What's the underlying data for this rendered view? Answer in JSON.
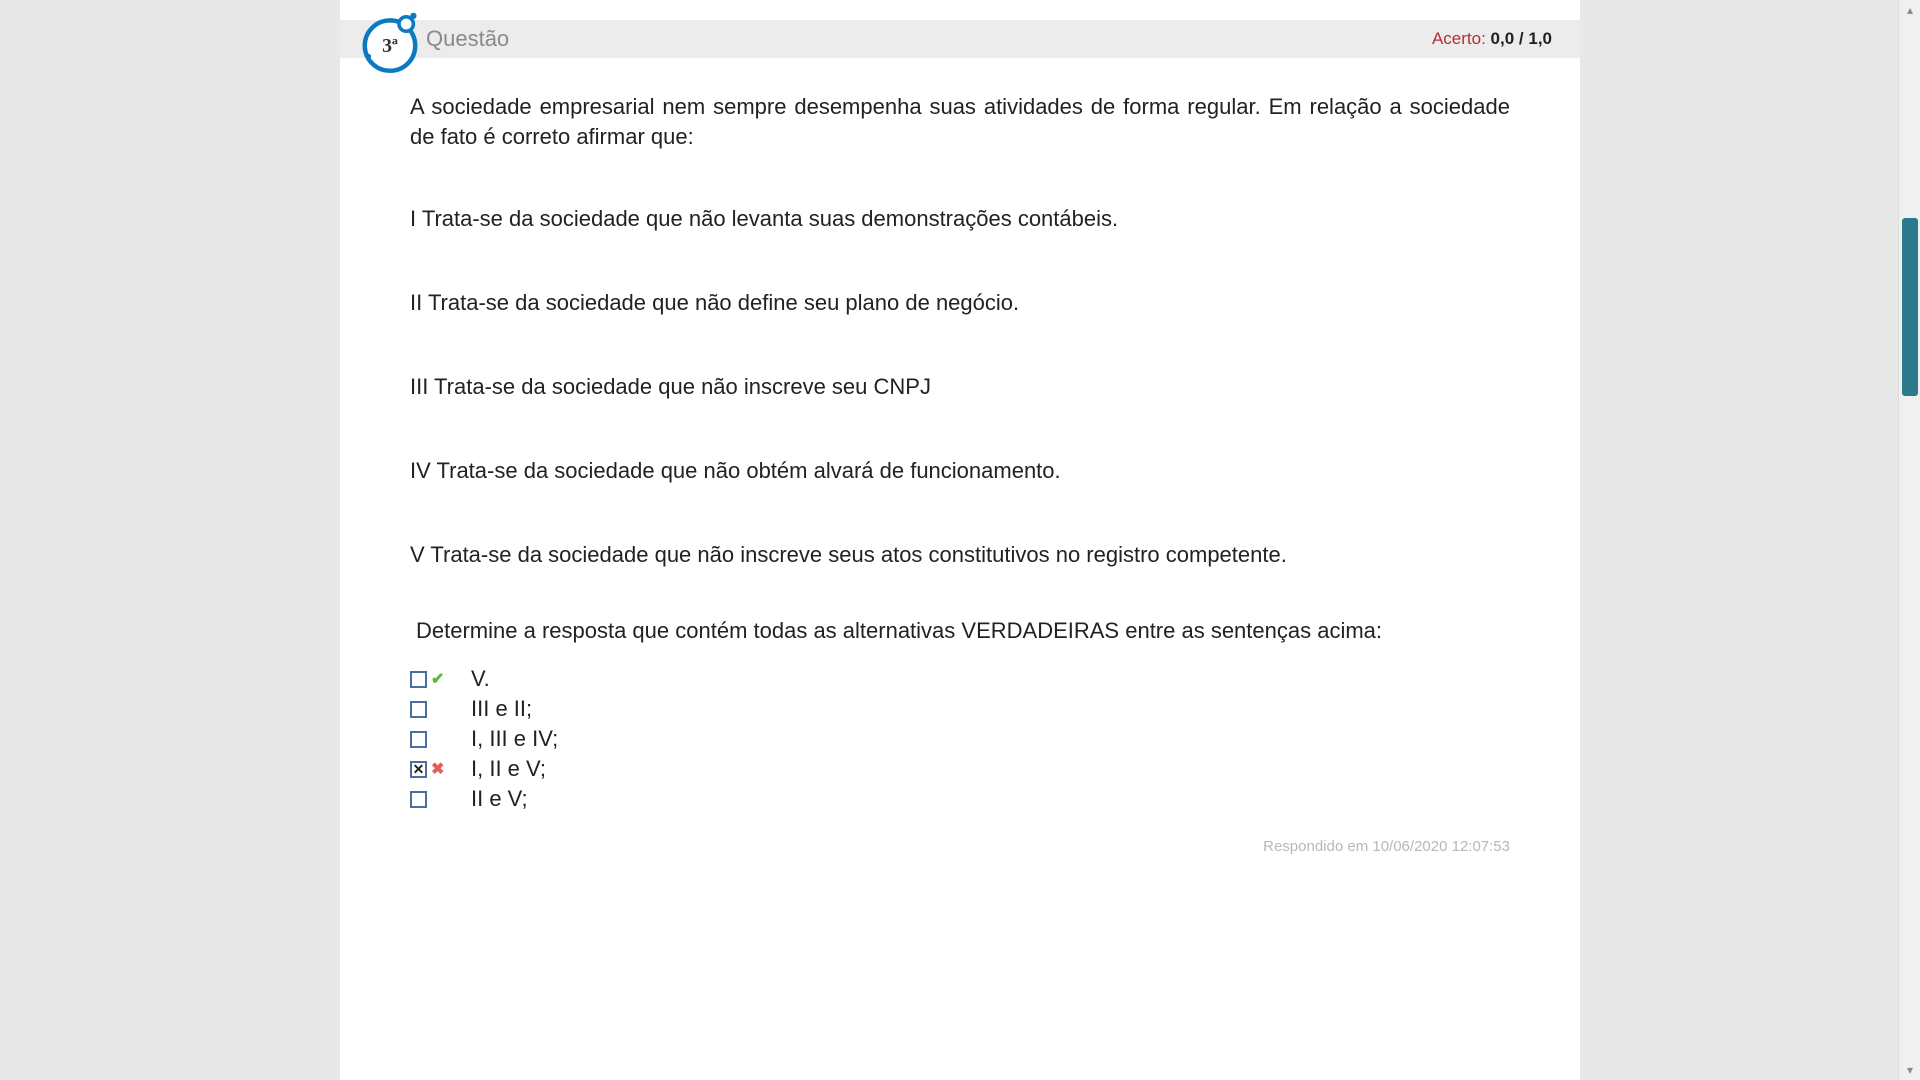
{
  "header": {
    "question_number": "3ª",
    "question_label": "Questão",
    "score_label": "Acerto: ",
    "score_got": "0,0",
    "score_sep": " / ",
    "score_max": "1,0"
  },
  "prompt": "A sociedade empresarial nem sempre desempenha suas atividades de forma regular. Em relação a sociedade de fato é correto afirmar que:",
  "statements": [
    "I  Trata-se da sociedade que não levanta suas demonstrações contábeis.",
    "II  Trata-se da sociedade que não define seu plano de negócio.",
    "III  Trata-se da sociedade que não inscreve seu CNPJ",
    "IV  Trata-se da sociedade que não obtém alvará de funcionamento.",
    "V  Trata-se da sociedade que não inscreve seus atos constitutivos no registro competente."
  ],
  "instruction": "Determine a resposta que contém todas as alternativas VERDADEIRAS entre as sentenças acima:",
  "options": [
    {
      "label": "V.",
      "checked": false,
      "mark": "correct"
    },
    {
      "label": "III e II;",
      "checked": false,
      "mark": ""
    },
    {
      "label": "I, III e IV;",
      "checked": false,
      "mark": ""
    },
    {
      "label": "I, II e V;",
      "checked": true,
      "mark": "wrong"
    },
    {
      "label": "II e V;",
      "checked": false,
      "mark": ""
    }
  ],
  "answered_text": "Respondido em 10/06/2020 12:07:53",
  "icons": {
    "correct_glyph": "✔",
    "wrong_glyph": "✖",
    "x_glyph": "✕"
  }
}
